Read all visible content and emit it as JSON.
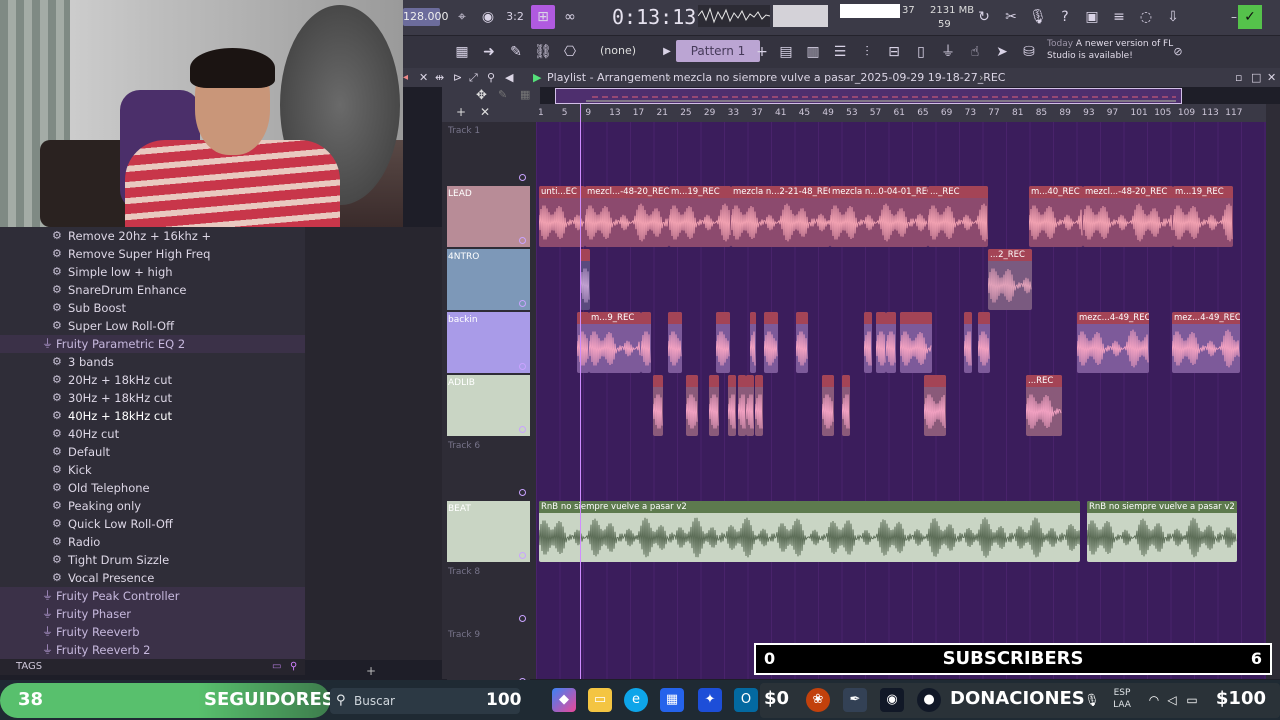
{
  "toolbar": {
    "bpm": "128.000",
    "time": "0:13:13",
    "cpu_mem": "2131 MB",
    "cpu_val": "37",
    "poly": "59",
    "snap": "(none)",
    "pattern": "Pattern 1",
    "news_today": "Today",
    "news_text": "A newer version of FL Studio is available!"
  },
  "browser": {
    "items": [
      {
        "label": "Remove 20hz + 16khz +",
        "type": "preset"
      },
      {
        "label": "Remove Super High Freq",
        "type": "preset"
      },
      {
        "label": "Simple low + high",
        "type": "preset"
      },
      {
        "label": "SnareDrum Enhance",
        "type": "preset"
      },
      {
        "label": "Sub Boost",
        "type": "preset"
      },
      {
        "label": "Super Low Roll-Off",
        "type": "preset"
      },
      {
        "label": "Fruity Parametric EQ 2",
        "type": "plugin"
      },
      {
        "label": "3 bands",
        "type": "preset"
      },
      {
        "label": "20Hz + 18kHz cut",
        "type": "preset"
      },
      {
        "label": "30Hz + 18kHz cut",
        "type": "preset"
      },
      {
        "label": "40Hz + 18kHz cut",
        "type": "preset",
        "active": true
      },
      {
        "label": "40Hz cut",
        "type": "preset"
      },
      {
        "label": "Default",
        "type": "preset"
      },
      {
        "label": "Kick",
        "type": "preset"
      },
      {
        "label": "Old Telephone",
        "type": "preset"
      },
      {
        "label": "Peaking only",
        "type": "preset"
      },
      {
        "label": "Quick Low Roll-Off",
        "type": "preset"
      },
      {
        "label": "Radio",
        "type": "preset"
      },
      {
        "label": "Tight Drum Sizzle",
        "type": "preset"
      },
      {
        "label": "Vocal Presence",
        "type": "preset"
      },
      {
        "label": "Fruity Peak Controller",
        "type": "plugin"
      },
      {
        "label": "Fruity Phaser",
        "type": "plugin"
      },
      {
        "label": "Fruity Reeverb",
        "type": "plugin"
      },
      {
        "label": "Fruity Reeverb 2",
        "type": "plugin"
      }
    ],
    "tags_label": "TAGS"
  },
  "playlist": {
    "title": "Playlist - Arrangement",
    "project": "mezcla no siempre vulve a pasar_2025-09-29 19-18-27_REC",
    "ruler": [
      "1",
      "5",
      "9",
      "13",
      "17",
      "21",
      "25",
      "29",
      "33",
      "37",
      "41",
      "45",
      "49",
      "53",
      "57",
      "61",
      "65",
      "69",
      "73",
      "77",
      "81",
      "85",
      "89",
      "93",
      "97",
      "101",
      "105",
      "109",
      "113",
      "117"
    ],
    "tracks": [
      {
        "name": "Track 1",
        "color": "#2e2c36"
      },
      {
        "name": "LEAD",
        "color": "#b88c97"
      },
      {
        "name": "4NTRO",
        "color": "#7d98b8"
      },
      {
        "name": "backin",
        "color": "#a99be8"
      },
      {
        "name": "ADLIB",
        "color": "#c9d5c4"
      },
      {
        "name": "Track 6",
        "color": "#2e2c36"
      },
      {
        "name": "BEAT",
        "color": "#c9d5c4"
      },
      {
        "name": "Track 8",
        "color": "#2e2c36"
      },
      {
        "name": "Track 9",
        "color": "#2e2c36"
      }
    ],
    "clips": {
      "lead": [
        "unti...EC",
        "mezcl...-48-20_REC",
        "m...19_REC",
        "mezcla n...2-21-48_REC",
        "mezcla n...0-04-01_REC",
        "..._REC",
        "m...40_REC",
        "mezcl...-48-20_REC",
        "m...19_REC"
      ],
      "intro": [
        "...2_REC"
      ],
      "backin": [
        "m...9_REC",
        "mezc...4-49_REC",
        "mez...4-49_REC"
      ],
      "adlib": [
        "...REC"
      ],
      "beat": [
        "RnB no siempre vuelve a pasar v2",
        "RnB no siempre vuelve a pasar v2"
      ]
    }
  },
  "overlay": {
    "subs_left": "0",
    "subs_label": "SUBSCRIBERS",
    "subs_right": "6"
  },
  "taskbar": {
    "seg_count": "38",
    "seg_label": "SEGUIDORES",
    "search_placeholder": "Buscar",
    "seg_goal": "100",
    "don_left": "$0",
    "don_label": "DONACIONES",
    "don_right": "$100",
    "lang": "ESP",
    "lang2": "LAA"
  }
}
